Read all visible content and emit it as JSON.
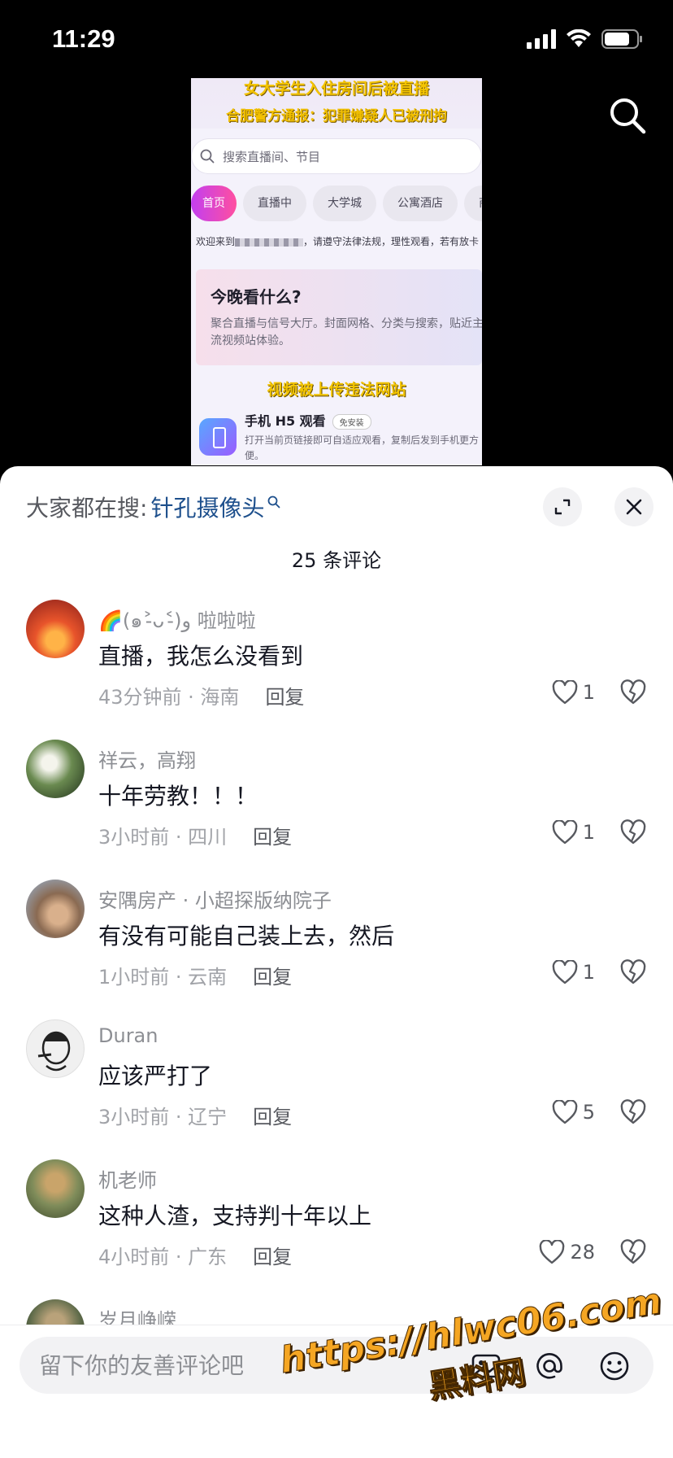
{
  "status": {
    "time": "11:29"
  },
  "video": {
    "headline_top": "女大学生入住房间后被直播",
    "headline_bottom": "合肥警方通报：犯罪嫌疑人已被刑拘",
    "search_placeholder": "搜索直播间、节目",
    "categories": [
      "首页",
      "直播中",
      "大学城",
      "公寓酒店",
      "商业"
    ],
    "ticker_prefix": "欢迎来到",
    "ticker_suffix": "，请遵守法律法规，理性观看，若有放卡",
    "card_title": "今晚看什么?",
    "card_desc": "聚合直播与信号大厅。封面网格、分类与搜索，贴近主流视频站体验。",
    "overlay_caption": "视频被上传违法网站",
    "h5_title": "手机 H5 观看",
    "h5_badge": "免安装",
    "h5_desc": "打开当前页链接即可自适应观看，复制后发到手机更方便。"
  },
  "panel": {
    "trending_label": "大家都在搜:",
    "trending_keyword": "针孔摄像头",
    "comment_count": "25 条评论",
    "reply_label": "回复",
    "comments": [
      {
        "name": "🌈(๑˃̵ᴗ˂̵)و 啦啦啦",
        "text": "直播，我怎么没看到",
        "meta": "43分钟前 · 海南",
        "likes": "1",
        "avatar_color": "#d9472b"
      },
      {
        "name": "祥云，高翔",
        "text": "十年劳教！！！",
        "meta": "3小时前 · 四川",
        "likes": "1",
        "avatar_color": "#3f5a36"
      },
      {
        "name": "安隅房产 · 小超探版纳院子",
        "text": "有没有可能自己装上去，然后",
        "meta": "1小时前 · 云南",
        "likes": "1",
        "avatar_color": "#6d8fb3"
      },
      {
        "name": "Duran",
        "text": "应该严打了",
        "meta": "3小时前 · 辽宁",
        "likes": "5",
        "avatar_color": "#e8e8e8"
      },
      {
        "name": "机老师",
        "text": "这种人渣，支持判十年以上",
        "meta": "4小时前 · 广东",
        "likes": "28",
        "avatar_color": "#7f8c5a"
      },
      {
        "name": "岁月峥嵘",
        "text": "",
        "meta": "",
        "likes": "",
        "avatar_color": "#5e6b4a"
      }
    ]
  },
  "input": {
    "placeholder": "留下你的友善评论吧"
  },
  "watermark": {
    "url": "https://hlwc06.com",
    "name": "黑料网"
  }
}
